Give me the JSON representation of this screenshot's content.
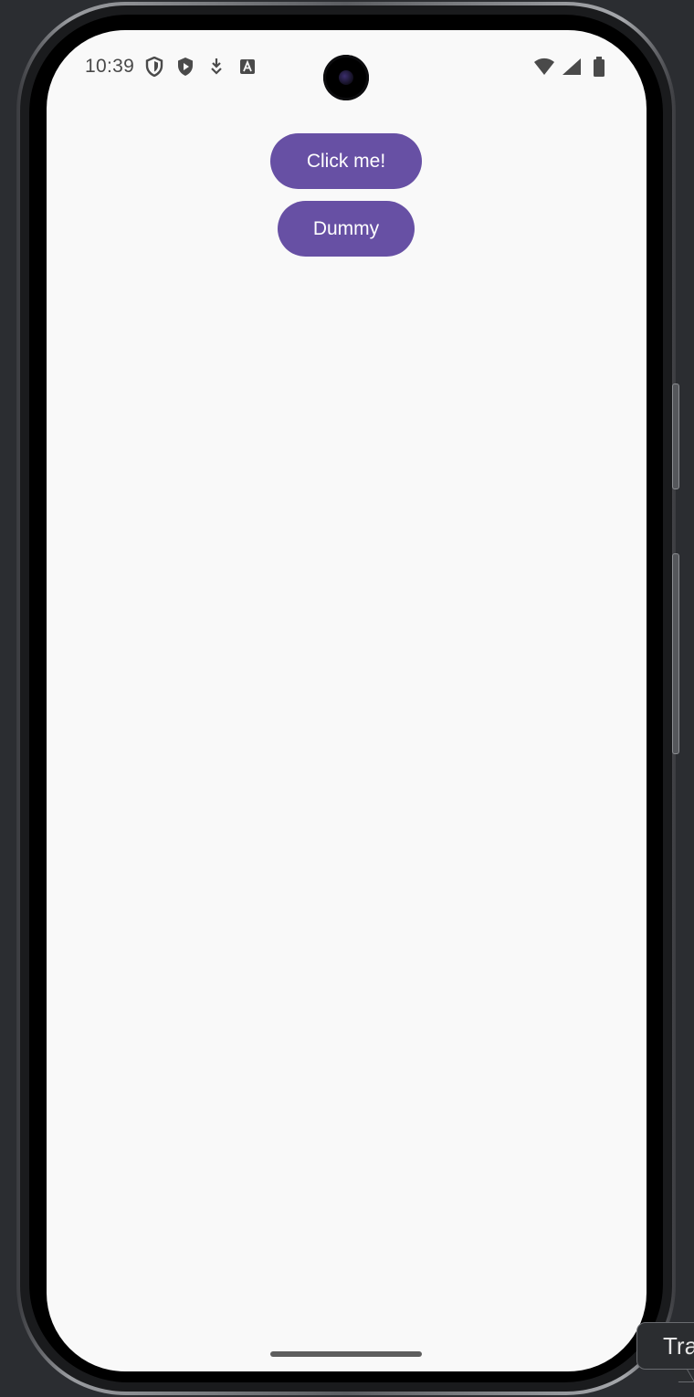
{
  "status_bar": {
    "time": "10:39",
    "left_icons": [
      "shield-outline-icon",
      "play-shield-icon",
      "download-arrow-icon",
      "font-a-icon"
    ],
    "right_icons": [
      "wifi-icon",
      "cellular-signal-icon",
      "battery-icon"
    ]
  },
  "main": {
    "click_button_label": "Click me!",
    "dummy_button_label": "Dummy"
  },
  "tooltip": {
    "text": "Tra"
  },
  "colors": {
    "primary": "#6750a4",
    "screen_background": "#f9f9f9",
    "window_background": "#2b2d31"
  }
}
